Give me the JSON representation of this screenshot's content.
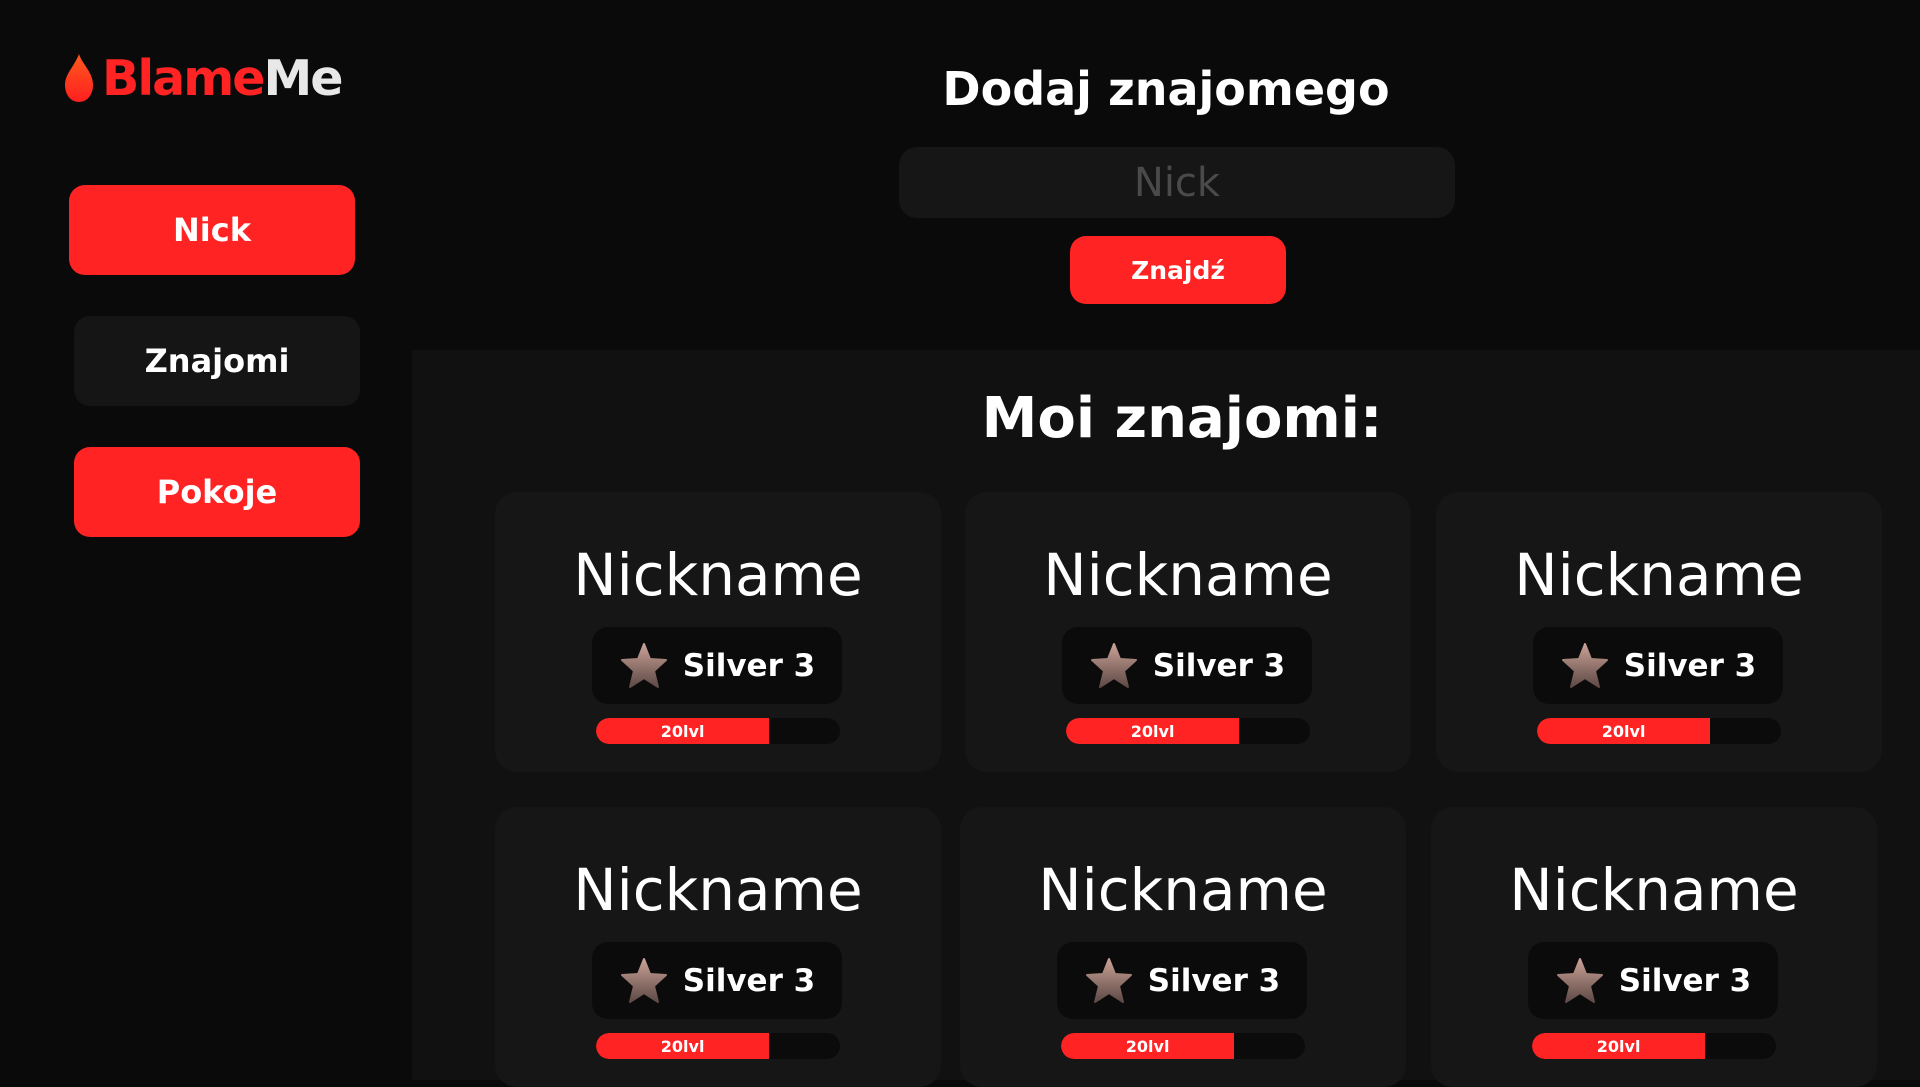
{
  "app": {
    "logo_part1": "Blame",
    "logo_part2": "Me",
    "logo_icon": "flame-icon"
  },
  "colors": {
    "accent": "#ff2323",
    "background": "#0a0a0a",
    "panel": "#111111",
    "card": "#161616",
    "badge": "#0b0b0b",
    "star_top": "#caa196",
    "star_bottom": "#5e4a46"
  },
  "sidebar": {
    "items": [
      {
        "label": "Nick",
        "style": "red"
      },
      {
        "label": "Znajomi",
        "style": "dark"
      },
      {
        "label": "Pokoje",
        "style": "red"
      }
    ]
  },
  "add_friend": {
    "title": "Dodaj znajomego",
    "input_placeholder": "Nick",
    "input_value": "",
    "button_label": "Znajdź"
  },
  "friends": {
    "title": "Moi znajomi:",
    "rank_icon": "star-icon",
    "list": [
      {
        "nickname": "Nickname",
        "rank": "Silver 3",
        "level": "20lvl",
        "progress": 0.71
      },
      {
        "nickname": "Nickname",
        "rank": "Silver 3",
        "level": "20lvl",
        "progress": 0.71
      },
      {
        "nickname": "Nickname",
        "rank": "Silver 3",
        "level": "20lvl",
        "progress": 0.71
      },
      {
        "nickname": "Nickname",
        "rank": "Silver 3",
        "level": "20lvl",
        "progress": 0.71
      },
      {
        "nickname": "Nickname",
        "rank": "Silver 3",
        "level": "20lvl",
        "progress": 0.71
      },
      {
        "nickname": "Nickname",
        "rank": "Silver 3",
        "level": "20lvl",
        "progress": 0.71
      }
    ]
  }
}
